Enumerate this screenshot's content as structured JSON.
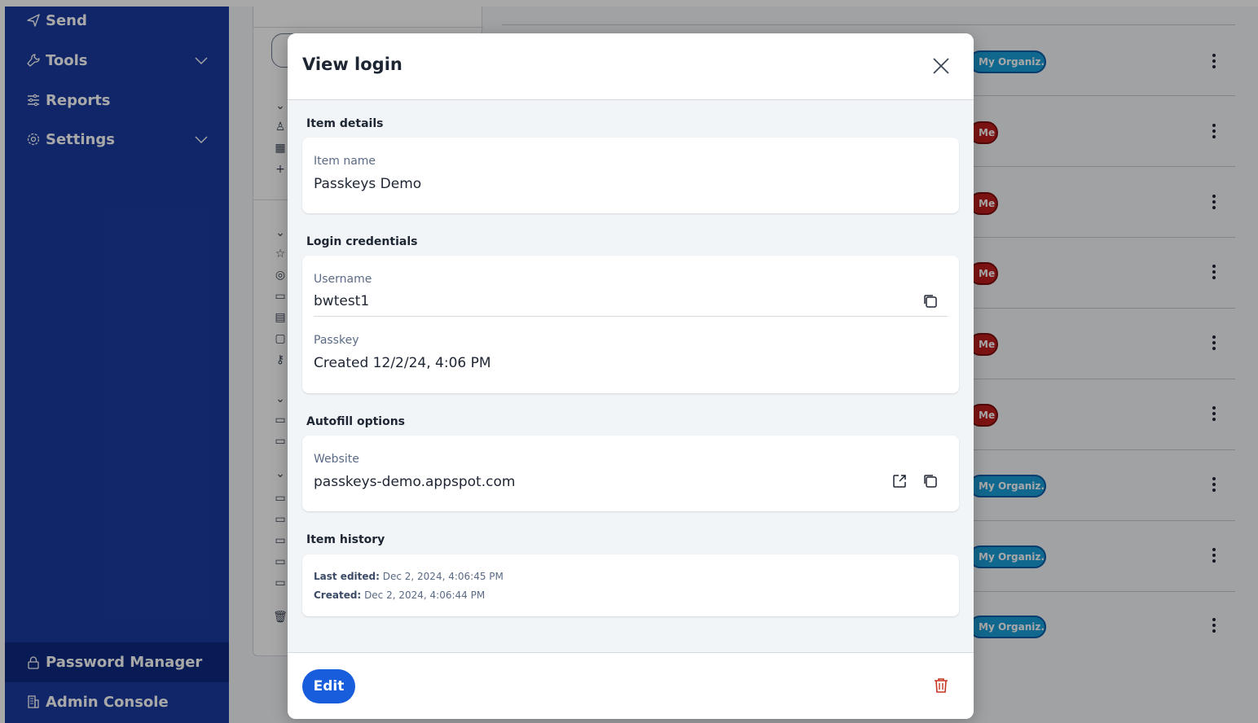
{
  "sidebar": {
    "items": [
      {
        "label": "Send",
        "icon": "send-icon"
      },
      {
        "label": "Tools",
        "icon": "wrench-icon",
        "expandable": true
      },
      {
        "label": "Reports",
        "icon": "sliders-icon"
      },
      {
        "label": "Settings",
        "icon": "gear-icon",
        "expandable": true
      }
    ],
    "bottom": [
      {
        "label": "Password Manager",
        "icon": "lock-icon",
        "active": true
      },
      {
        "label": "Admin Console",
        "icon": "building-icon"
      }
    ]
  },
  "background": {
    "badges": [
      "My Organiz...",
      "Me",
      "Me",
      "Me",
      "Me",
      "Me",
      "My Organiz...",
      "My Organiz...",
      "My Organiz..."
    ]
  },
  "modal": {
    "title": "View login",
    "item_details": {
      "section_title": "Item details",
      "item_name_label": "Item name",
      "item_name_value": "Passkeys Demo"
    },
    "login_credentials": {
      "section_title": "Login credentials",
      "username_label": "Username",
      "username_value": "bwtest1",
      "passkey_label": "Passkey",
      "passkey_value": "Created 12/2/24, 4:06 PM"
    },
    "autofill": {
      "section_title": "Autofill options",
      "website_label": "Website",
      "website_value": "passkeys-demo.appspot.com"
    },
    "history": {
      "section_title": "Item history",
      "last_edited_label": "Last edited:",
      "last_edited_value": "Dec 2, 2024, 4:06:45 PM",
      "created_label": "Created:",
      "created_value": "Dec 2, 2024, 4:06:44 PM"
    },
    "footer": {
      "edit_label": "Edit"
    }
  },
  "colors": {
    "sidebar_bg": "#1a3b9f",
    "primary": "#175ddc",
    "danger": "#c83522",
    "org_badge": "#1b9fd8",
    "me_badge": "#c01e1e"
  }
}
